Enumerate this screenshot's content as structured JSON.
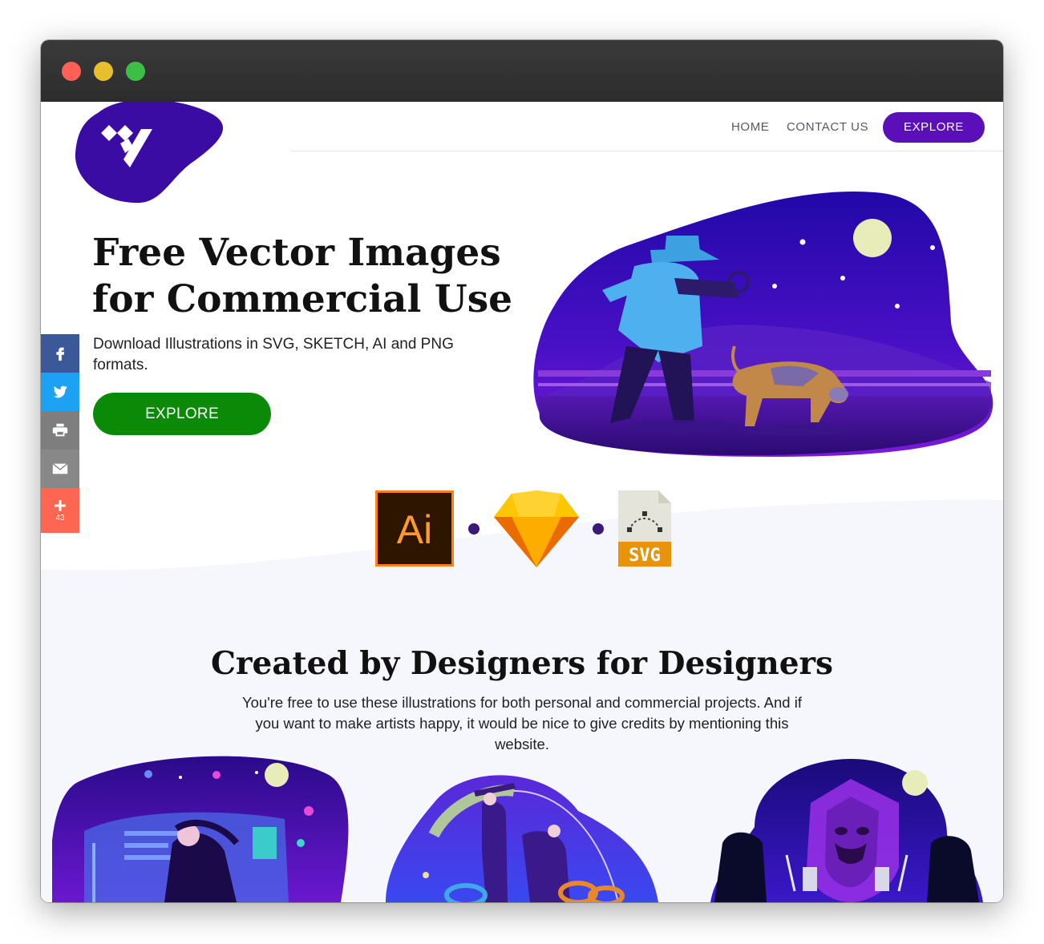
{
  "nav": {
    "home": "HOME",
    "contact": "CONTACT US",
    "explore": "EXPLORE"
  },
  "hero": {
    "title_line1": "Free Vector Images",
    "title_line2": "for Commercial Use",
    "subtitle": "Download Illustrations in SVG, SKETCH, AI and PNG formats.",
    "button": "EXPLORE"
  },
  "formats": {
    "ai_label": "Ai",
    "svg_label": "SVG"
  },
  "social": {
    "share_count": "43"
  },
  "section": {
    "title": "Created by Designers for Designers",
    "text": "You're free to use these illustrations for both personal and commercial projects. And if you want to make artists happy, it would be nice to give credits by mentioning this website."
  },
  "colors": {
    "brand_purple": "#5b0fb8",
    "logo_blue": "#3a0ca3",
    "explore_green": "#0a8a06",
    "facebook": "#3b5998",
    "twitter": "#1da1f2",
    "print": "#7e7e7e",
    "email": "#888888",
    "more": "#fd6650"
  },
  "icons": [
    "facebook-icon",
    "twitter-icon",
    "printer-icon",
    "envelope-icon",
    "plus-icon",
    "adobe-illustrator-icon",
    "sketch-icon",
    "svg-file-icon"
  ]
}
